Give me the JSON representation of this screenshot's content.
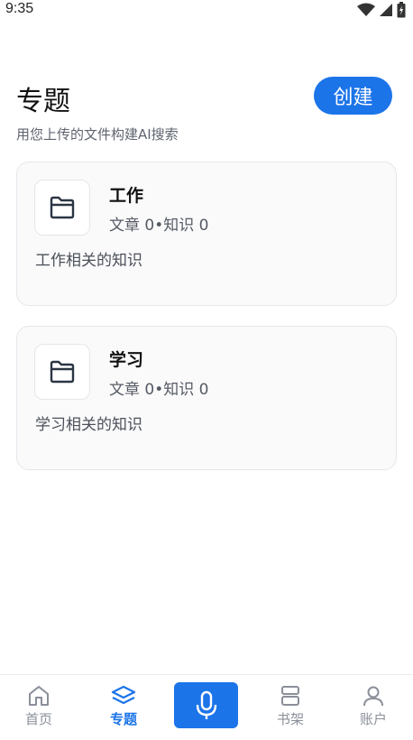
{
  "status_bar": {
    "time": "9:35"
  },
  "header": {
    "title": "专题",
    "create_label": "创建",
    "subtitle": "用您上传的文件构建AI搜索"
  },
  "topics": [
    {
      "title": "工作",
      "meta": "文章 0•知识 0",
      "description": "工作相关的知识",
      "icon": "folder-icon"
    },
    {
      "title": "学习",
      "meta": "文章 0•知识 0",
      "description": "学习相关的知识",
      "icon": "folder-icon"
    }
  ],
  "bottom_nav": {
    "items": [
      {
        "label": "首页",
        "icon": "home-icon",
        "active": false
      },
      {
        "label": "专题",
        "icon": "layers-icon",
        "active": true
      },
      {
        "label": "书架",
        "icon": "bookshelf-icon",
        "active": false
      },
      {
        "label": "账户",
        "icon": "user-icon",
        "active": false
      }
    ],
    "mic_icon": "microphone-icon"
  },
  "colors": {
    "accent": "#1c74e9",
    "card_bg": "#fafafb",
    "text_muted": "#5f6470"
  }
}
